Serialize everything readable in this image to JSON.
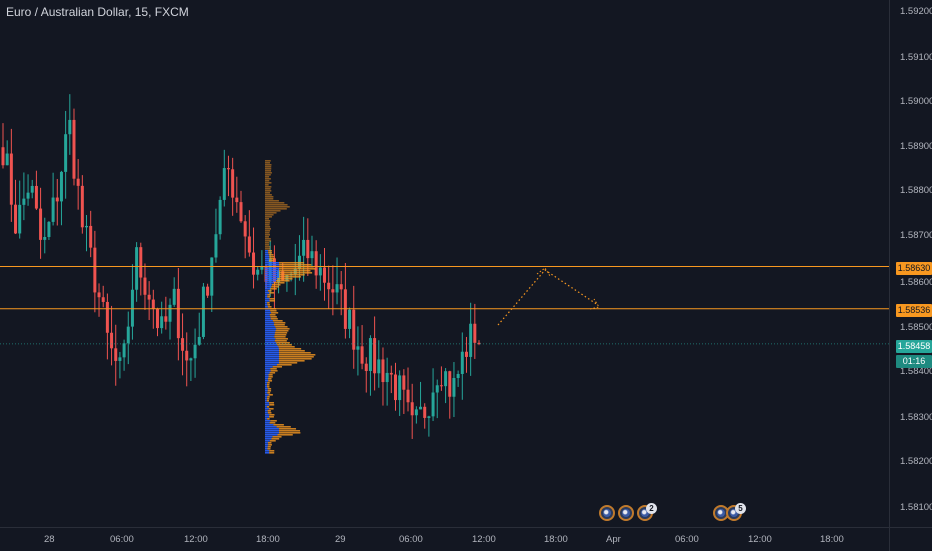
{
  "header": {
    "symbol_title": "Euro / Australian Dollar, 15, FXCM"
  },
  "price_axis": {
    "ticks": [
      "1.59200",
      "1.59100",
      "1.59000",
      "1.58900",
      "1.58800",
      "1.58700",
      "1.58600",
      "1.58500",
      "1.58400",
      "1.58300",
      "1.58200",
      "1.58100"
    ],
    "tags": {
      "upper_level": "1.58630",
      "lower_level": "1.58536",
      "last_price": "1.58458",
      "countdown": "01:16"
    }
  },
  "time_axis": {
    "ticks": [
      "28",
      "06:00",
      "12:00",
      "18:00",
      "29",
      "06:00",
      "12:00",
      "18:00",
      "Apr",
      "06:00",
      "12:00",
      "18:00"
    ]
  },
  "events": [
    {
      "icon": "eu-flag-icon",
      "badge": ""
    },
    {
      "icon": "eu-flag-icon",
      "badge": ""
    },
    {
      "icon": "eu-flag-icon",
      "badge": "2"
    },
    {
      "icon": "eu-flag-icon",
      "badge": ""
    },
    {
      "icon": "eu-flag-icon",
      "badge": "5"
    }
  ],
  "colors": {
    "background": "#131722",
    "up": "#26a69a",
    "down": "#ef5350",
    "level_line": "#f89820",
    "profile_blue": "#2962ff",
    "profile_orange": "#f89820"
  },
  "chart_data": {
    "type": "candlestick",
    "symbol": "EURAUD",
    "interval": "15",
    "ylim": [
      1.581,
      1.592
    ],
    "horizontal_levels": [
      1.5863,
      1.58536
    ],
    "last_price": 1.58458,
    "anchors": [
      [
        "day28_00",
        1.589
      ],
      [
        "day28_01",
        1.5872
      ],
      [
        "day28_02",
        1.5882
      ],
      [
        "day28_03",
        1.5866
      ],
      [
        "day28_04",
        1.5878
      ],
      [
        "day28_05",
        1.5895
      ],
      [
        "day28_06",
        1.5872
      ],
      [
        "day28_07",
        1.586
      ],
      [
        "day28_08",
        1.5845
      ],
      [
        "day28_09",
        1.5838
      ],
      [
        "day28_10",
        1.5865
      ],
      [
        "day28_11",
        1.5858
      ],
      [
        "day28_12",
        1.5848
      ],
      [
        "day28_13",
        1.5855
      ],
      [
        "day28_14",
        1.584
      ],
      [
        "day28_15",
        1.5852
      ],
      [
        "day28_16",
        1.587
      ],
      [
        "day28_17",
        1.5885
      ],
      [
        "day28_18",
        1.5875
      ],
      [
        "day28_19",
        1.5862
      ],
      [
        "day28_20",
        1.5862
      ],
      [
        "day28_21",
        1.5858
      ],
      [
        "day28_22",
        1.5862
      ],
      [
        "day28_23",
        1.5866
      ],
      [
        "day29_00",
        1.5862
      ],
      [
        "day29_01",
        1.5858
      ],
      [
        "day29_02",
        1.5852
      ],
      [
        "day29_03",
        1.5845
      ],
      [
        "day29_04",
        1.5842
      ],
      [
        "day29_05",
        1.584
      ],
      [
        "day29_06",
        1.5835
      ],
      [
        "day29_07",
        1.5826
      ],
      [
        "day29_08",
        1.5832
      ],
      [
        "day29_09",
        1.5842
      ],
      [
        "day29_10",
        1.5835
      ],
      [
        "day29_11",
        1.5845
      ],
      [
        "day29_12",
        1.585
      ]
    ],
    "projection": [
      [
        1.585,
        1.5863
      ],
      [
        1.5863,
        1.5854
      ]
    ]
  }
}
